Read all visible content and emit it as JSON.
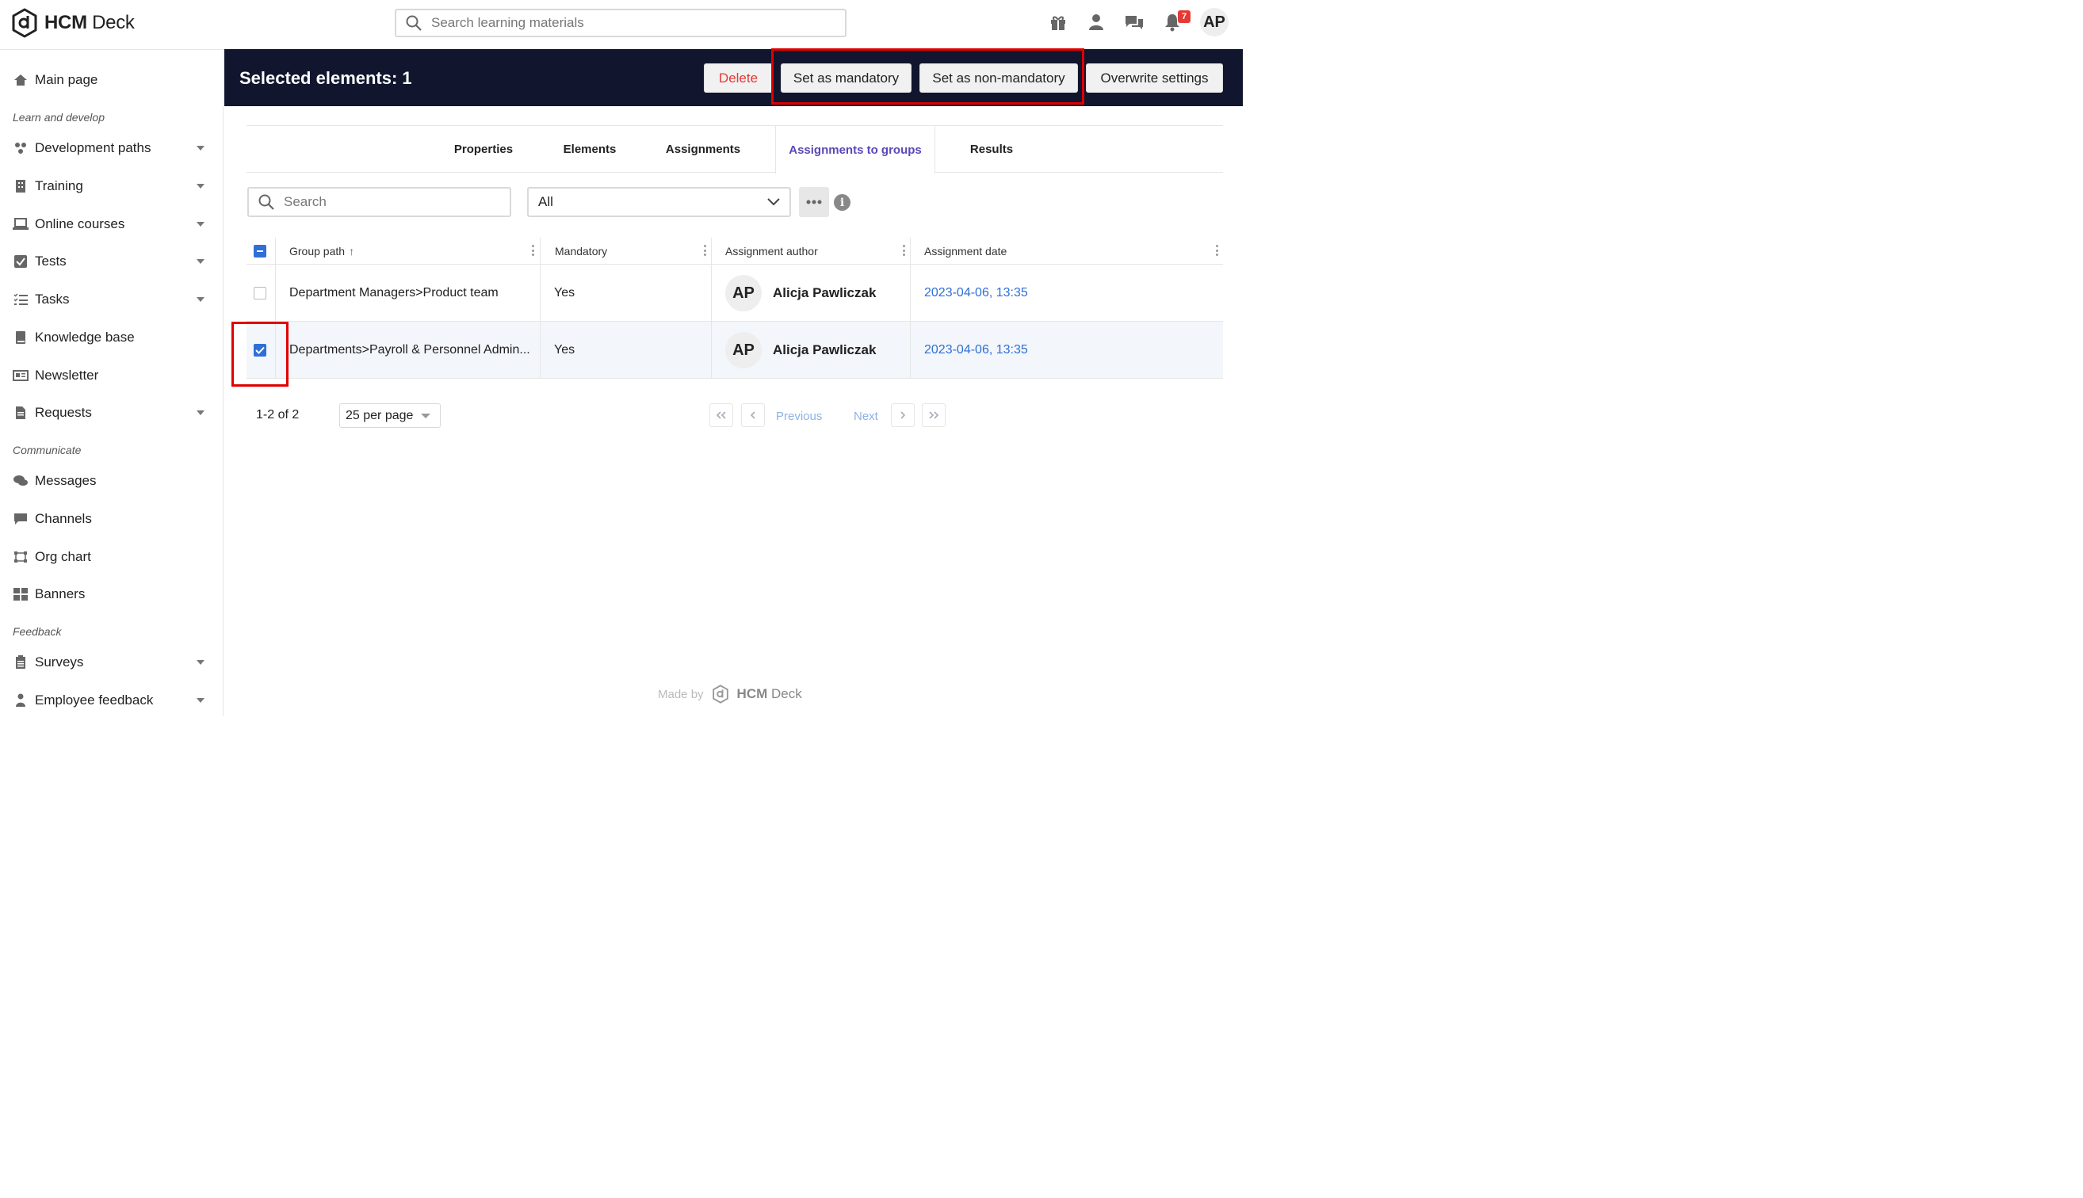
{
  "app": {
    "logo_bold": "HCM",
    "logo_rest": " Deck"
  },
  "header": {
    "search_placeholder": "Search learning materials",
    "notification_count": "7",
    "avatar_initials": "AP"
  },
  "sidebar": {
    "main": {
      "label": "Main page",
      "icon": "home-icon"
    },
    "sections": [
      {
        "title": "Learn and develop"
      },
      {
        "title": "Communicate"
      },
      {
        "title": "Feedback"
      }
    ],
    "items": [
      {
        "label": "Development paths",
        "icon": "development-paths-icon",
        "expandable": true
      },
      {
        "label": "Training",
        "icon": "training-icon",
        "expandable": true
      },
      {
        "label": "Online courses",
        "icon": "laptop-icon",
        "expandable": true
      },
      {
        "label": "Tests",
        "icon": "checkbox-icon",
        "expandable": true
      },
      {
        "label": "Tasks",
        "icon": "tasks-icon",
        "expandable": true
      },
      {
        "label": "Knowledge base",
        "icon": "book-icon",
        "expandable": false
      },
      {
        "label": "Newsletter",
        "icon": "newsletter-icon",
        "expandable": false
      },
      {
        "label": "Requests",
        "icon": "document-icon",
        "expandable": true
      },
      {
        "label": "Messages",
        "icon": "messages-icon",
        "expandable": false
      },
      {
        "label": "Channels",
        "icon": "channel-icon",
        "expandable": false
      },
      {
        "label": "Org chart",
        "icon": "org-chart-icon",
        "expandable": false
      },
      {
        "label": "Banners",
        "icon": "banners-icon",
        "expandable": false
      },
      {
        "label": "Surveys",
        "icon": "survey-icon",
        "expandable": true
      },
      {
        "label": "Employee feedback",
        "icon": "employee-feedback-icon",
        "expandable": true
      }
    ]
  },
  "action_bar": {
    "selected_text": "Selected elements: 1",
    "delete_label": "Delete",
    "set_mandatory_label": "Set as mandatory",
    "set_non_mandatory_label": "Set as non-mandatory",
    "overwrite_label": "Overwrite settings"
  },
  "tabs": [
    {
      "label": "Properties",
      "active": false
    },
    {
      "label": "Elements",
      "active": false
    },
    {
      "label": "Assignments",
      "active": false
    },
    {
      "label": "Assignments to groups",
      "active": true
    },
    {
      "label": "Results",
      "active": false
    }
  ],
  "filters": {
    "search_placeholder": "Search",
    "select_value": "All"
  },
  "table": {
    "columns": [
      "Group path",
      "Mandatory",
      "Assignment author",
      "Assignment date"
    ],
    "sort_indicator": "↑",
    "rows": [
      {
        "group_path": "Department Managers>Product team",
        "mandatory": "Yes",
        "author_initials": "AP",
        "author": "Alicja Pawliczak",
        "date": "2023-04-06, 13:35",
        "checked": false
      },
      {
        "group_path": "Departments>Payroll & Personnel Admin...",
        "mandatory": "Yes",
        "author_initials": "AP",
        "author": "Alicja Pawliczak",
        "date": "2023-04-06, 13:35",
        "checked": true
      }
    ]
  },
  "pagination": {
    "count": "1-2 of 2",
    "per_page": "25 per page",
    "previous": "Previous",
    "next": "Next"
  },
  "footer": {
    "made_by": "Made by",
    "brand_bold": "HCM",
    "brand_rest": " Deck"
  },
  "colors": {
    "action_bar_bg": "#11162e",
    "accent_tab": "#5b47b8",
    "link": "#2f6fd6",
    "delete": "#e53935",
    "highlight": "#e00000"
  }
}
